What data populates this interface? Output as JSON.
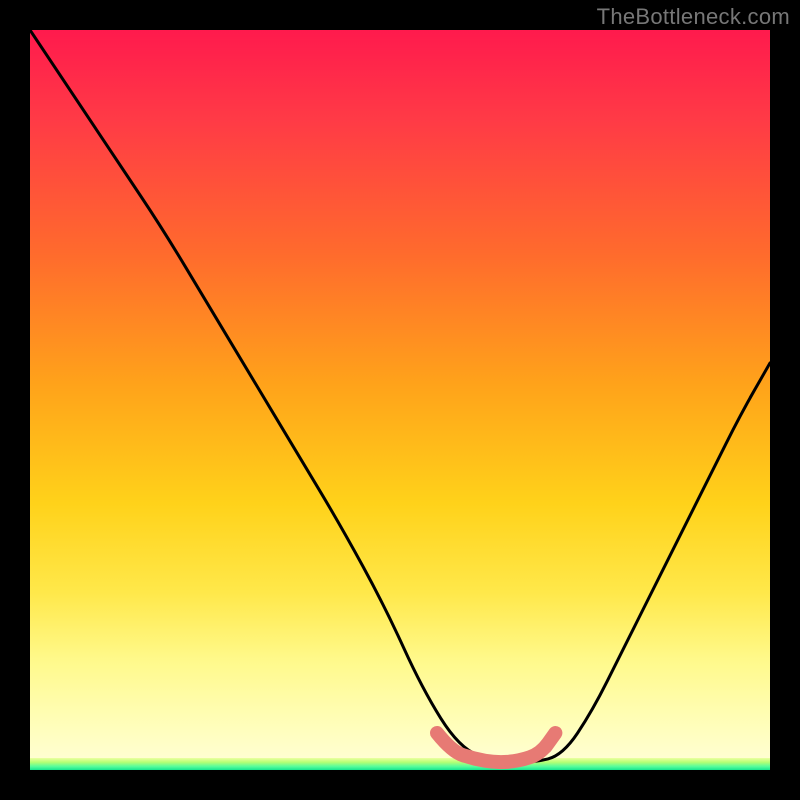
{
  "watermark": "TheBottleneck.com",
  "colors": {
    "frame_bg": "#000000",
    "gradient_top": "#ff1a4d",
    "gradient_bottom": "#ffffd9",
    "green_strip_bottom": "#16e58e",
    "curve_stroke": "#000000",
    "coral_stroke": "#e77a74"
  },
  "chart_data": {
    "type": "line",
    "title": "",
    "xlabel": "",
    "ylabel": "",
    "xlim": [
      0,
      100
    ],
    "ylim": [
      0,
      100
    ],
    "grid": false,
    "legend": false,
    "series": [
      {
        "name": "bottleneck-curve",
        "x": [
          0,
          6,
          12,
          18,
          24,
          30,
          36,
          42,
          48,
          53,
          58,
          63,
          68,
          72,
          76,
          80,
          84,
          88,
          92,
          96,
          100
        ],
        "values": [
          100,
          91,
          82,
          73,
          63,
          53,
          43,
          33,
          22,
          11,
          3,
          1,
          1,
          2,
          8,
          16,
          24,
          32,
          40,
          48,
          55
        ]
      },
      {
        "name": "coral-highlight",
        "x": [
          55,
          57,
          60,
          63,
          66,
          69,
          71
        ],
        "values": [
          5,
          2.5,
          1.5,
          1,
          1.2,
          2.2,
          5
        ]
      }
    ],
    "annotations": []
  }
}
